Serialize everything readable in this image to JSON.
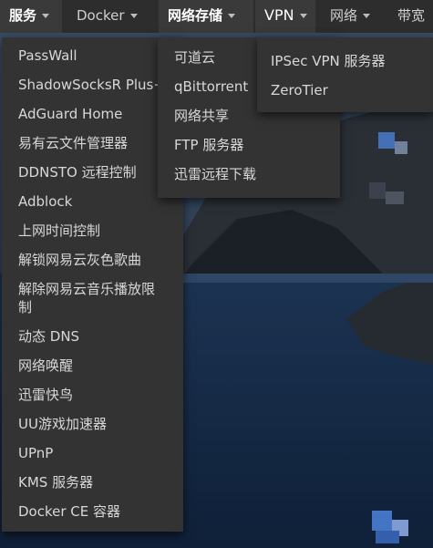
{
  "navbar": {
    "items": [
      {
        "label": "服务",
        "has_caret": true
      },
      {
        "label": "Docker",
        "has_caret": true
      },
      {
        "label": "网络存储",
        "has_caret": true
      },
      {
        "label": "VPN",
        "has_caret": true
      },
      {
        "label": "网络",
        "has_caret": true
      },
      {
        "label": "带宽",
        "has_caret": false
      }
    ]
  },
  "menus": {
    "services": [
      "PassWall",
      "ShadowSocksR Plus+",
      "AdGuard Home",
      "易有云文件管理器",
      "DDNSTO 远程控制",
      "Adblock",
      "上网时间控制",
      "解锁网易云灰色歌曲",
      "解除网易云音乐播放限制",
      "动态 DNS",
      "网络唤醒",
      "迅雷快鸟",
      "UU游戏加速器",
      "UPnP",
      "KMS 服务器",
      "Docker CE 容器"
    ],
    "storage": [
      "可道云",
      "qBittorrent",
      "网络共享",
      "FTP 服务器",
      "迅雷远程下载"
    ],
    "vpn": [
      "IPSec VPN 服务器",
      "ZeroTier"
    ]
  },
  "colors": {
    "navbar_bg": "#2d2d2d",
    "menu_bg": "#333333",
    "menu_text": "#d8d8d8"
  }
}
